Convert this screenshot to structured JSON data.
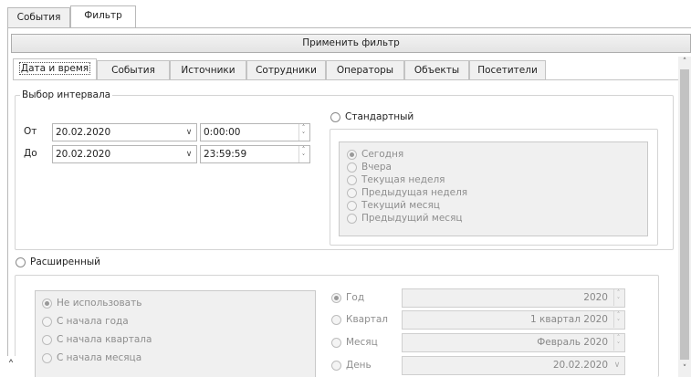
{
  "top_tabs": [
    {
      "label": "События",
      "active": false
    },
    {
      "label": "Фильтр",
      "active": true
    }
  ],
  "apply_button": "Применить фильтр",
  "inner_tabs": [
    {
      "label": "Дата и время",
      "active": true
    },
    {
      "label": "События"
    },
    {
      "label": "Источники"
    },
    {
      "label": "Сотрудники"
    },
    {
      "label": "Операторы"
    },
    {
      "label": "Объекты"
    },
    {
      "label": "Посетители"
    }
  ],
  "interval": {
    "legend": "Выбор интервала",
    "from_label": "От",
    "to_label": "До",
    "from_date": "20.02.2020",
    "from_time": "0:00:00",
    "to_date": "20.02.2020",
    "to_time": "23:59:59"
  },
  "standard": {
    "label": "Стандартный",
    "options": [
      "Сегодня",
      "Вчера",
      "Текущая неделя",
      "Предыдущая неделя",
      "Текущий месяц",
      "Предыдущий месяц"
    ],
    "selected_index": 0
  },
  "extended": {
    "label": "Расширенный",
    "options": [
      "Не использовать",
      "С начала года",
      "С начала квартала",
      "С начала месяца"
    ],
    "selected_index": 0,
    "periods": [
      {
        "label": "Год",
        "value": "2020",
        "checked": true,
        "control": "spin"
      },
      {
        "label": "Квартал",
        "value": "1 квартал 2020",
        "checked": false,
        "control": "spin"
      },
      {
        "label": "Месяц",
        "value": "Февраль 2020",
        "checked": false,
        "control": "spin"
      },
      {
        "label": "День",
        "value": "20.02.2020",
        "checked": false,
        "control": "dropdown"
      }
    ]
  },
  "icons": {
    "dropdown": "chevron-down-icon",
    "spin": "spin-up-down-icon",
    "collapse": "chevron-up-icon",
    "scroll_up": "scroll-up-arrow-icon",
    "scroll_down": "scroll-down-arrow-icon"
  }
}
